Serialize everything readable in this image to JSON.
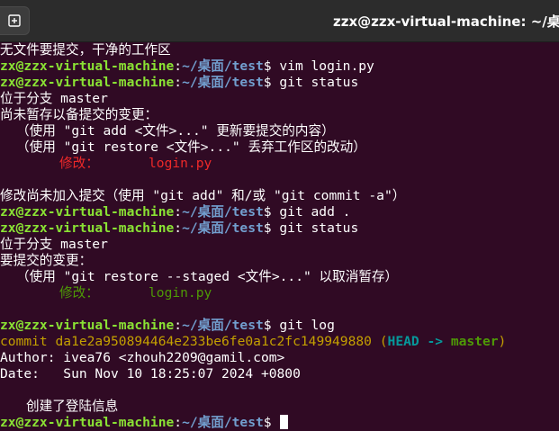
{
  "window": {
    "title": "zzx@zzx-virtual-machine: ~/桌面/tes"
  },
  "prompt": {
    "user": "zx@zzx-virtual-machine",
    "colon": ":",
    "path": "~/桌面/test",
    "symbol": "$"
  },
  "lines": {
    "l1": "无文件要提交，干净的工作区",
    "cmd1": " vim login.py",
    "cmd2": " git status",
    "l4": "位于分支 master",
    "l5": "尚未暂存以备提交的变更：",
    "l6": "（使用 \"git add <文件>...\" 更新要提交的内容）",
    "l7": "（使用 \"git restore <文件>...\" 丢弃工作区的改动）",
    "l8_label": "修改：",
    "l8_file": "login.py",
    "l10": "修改尚未加入提交（使用 \"git add\" 和/或 \"git commit -a\"）",
    "cmd3": " git add .",
    "cmd4": " git status",
    "l13": "位于分支 master",
    "l14": "要提交的变更：",
    "l15": "（使用 \"git restore --staged <文件>...\" 以取消暂存）",
    "l16_label": "修改：",
    "l16_file": "login.py",
    "cmd5": " git log",
    "commit_prefix": "commit da1e2a950894464e233be6fe0a1c2fc149949880",
    "commit_paren_open": " (",
    "commit_head": "HEAD -> ",
    "commit_branch": "master",
    "commit_paren_close": ")",
    "author": "Author: ivea76 <zhouh2209@gamil.com>",
    "date": "Date:   Sun Nov 10 18:25:07 2024 +0800",
    "message": "创建了登陆信息"
  },
  "colors": {
    "background": "#300a24",
    "prompt_user": "#8ae234",
    "prompt_path": "#729fcf",
    "modified": "#ef2929",
    "staged": "#4e9a06",
    "commit_hash": "#c4a000",
    "head_ref": "#06989a"
  },
  "icons": {
    "new_tab": "new-tab-icon"
  }
}
